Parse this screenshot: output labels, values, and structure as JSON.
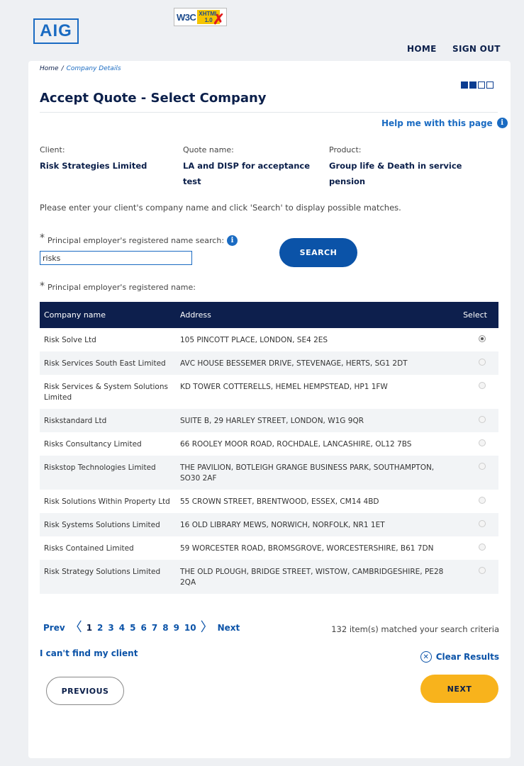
{
  "header": {
    "logo": "AIG",
    "badge": {
      "w3c": "W3C",
      "line1": "XHTML",
      "line2": "1.0",
      "mark": "✗"
    },
    "nav": {
      "home": "HOME",
      "signout": "SIGN OUT"
    }
  },
  "breadcrumb": {
    "home": "Home",
    "sep": "/",
    "current": "Company Details"
  },
  "steps": {
    "total": 4,
    "completed": 2
  },
  "page_title": "Accept Quote - Select Company",
  "help": {
    "label": "Help me with this page",
    "icon": "info-icon"
  },
  "quote": {
    "client_label": "Client:",
    "client_value": "Risk Strategies Limited",
    "quote_label": "Quote name:",
    "quote_value": "LA and DISP for acceptance test",
    "product_label": "Product:",
    "product_value": "Group life & Death in service pension"
  },
  "instruction": "Please enter your client's company name and click 'Search' to display possible matches.",
  "search": {
    "star": "*",
    "label": "Principal employer's registered name search:",
    "value": "risks",
    "button": "SEARCH"
  },
  "results_label": {
    "star": "*",
    "text": "Principal employer's registered name:"
  },
  "table": {
    "headers": {
      "company": "Company name",
      "address": "Address",
      "select": "Select"
    },
    "rows": [
      {
        "company": "Risk Solve Ltd",
        "address": "105 PINCOTT PLACE, LONDON, SE4 2ES",
        "selected": true
      },
      {
        "company": "Risk Services South East Limited",
        "address": "AVC HOUSE BESSEMER DRIVE, STEVENAGE, HERTS, SG1 2DT",
        "selected": false
      },
      {
        "company": "Risk Services & System Solutions Limited",
        "address": "KD TOWER COTTERELLS, HEMEL HEMPSTEAD, HP1 1FW",
        "selected": false
      },
      {
        "company": "Riskstandard Ltd",
        "address": "SUITE B, 29 HARLEY STREET, LONDON, W1G 9QR",
        "selected": false
      },
      {
        "company": "Risks Consultancy Limited",
        "address": "66 ROOLEY MOOR ROAD, ROCHDALE, LANCASHIRE, OL12 7BS",
        "selected": false
      },
      {
        "company": "Riskstop Technologies Limited",
        "address": "THE PAVILION, BOTLEIGH GRANGE BUSINESS PARK, SOUTHAMPTON, SO30 2AF",
        "selected": false
      },
      {
        "company": "Risk Solutions Within Property Ltd",
        "address": "55 CROWN STREET, BRENTWOOD, ESSEX, CM14 4BD",
        "selected": false
      },
      {
        "company": "Risk Systems Solutions Limited",
        "address": "16 OLD LIBRARY MEWS, NORWICH, NORFOLK, NR1 1ET",
        "selected": false
      },
      {
        "company": "Risks Contained Limited",
        "address": "59 WORCESTER ROAD, BROMSGROVE, WORCESTERSHIRE, B61 7DN",
        "selected": false
      },
      {
        "company": "Risk Strategy Solutions Limited",
        "address": "THE OLD PLOUGH, BRIDGE STREET, WISTOW, CAMBRIDGESHIRE, PE28 2QA",
        "selected": false
      }
    ]
  },
  "pagination": {
    "prev": "Prev",
    "next": "Next",
    "pages": [
      "1",
      "2",
      "3",
      "4",
      "5",
      "6",
      "7",
      "8",
      "9",
      "10"
    ],
    "current": "1"
  },
  "match_count": "132 item(s) matched your search criteria",
  "cant_find": "I can't find my client",
  "clear_results": "Clear Results",
  "buttons": {
    "previous": "PREVIOUS",
    "next": "NEXT"
  },
  "colors": {
    "navy": "#0d1f4d",
    "brand_blue": "#1a6bc2",
    "button_blue": "#0b53a8",
    "accent_yellow": "#f8b31c"
  }
}
